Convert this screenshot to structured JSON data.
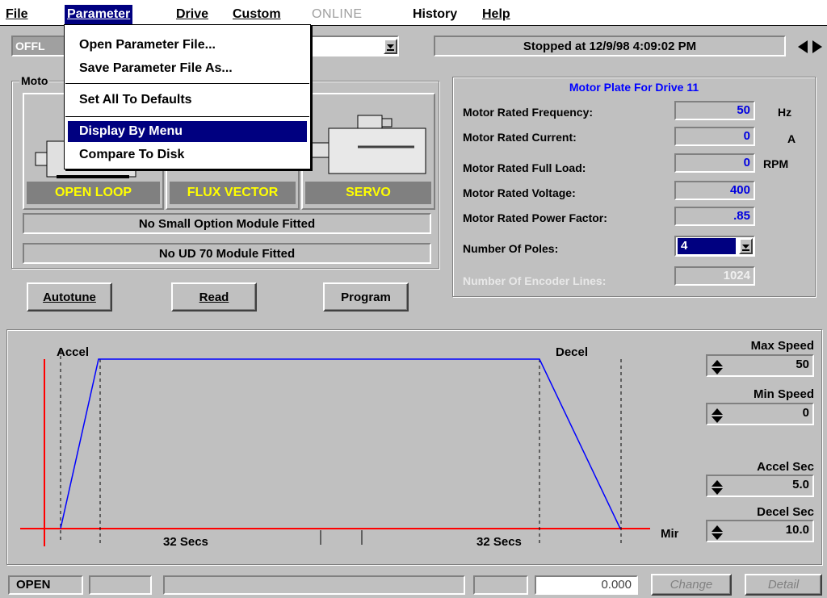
{
  "menubar": {
    "items": [
      "File",
      "Parameter",
      "Drive",
      "Custom",
      "ONLINE",
      "History",
      "Help"
    ]
  },
  "dropdown": {
    "items": [
      "Open Parameter File...",
      "Save Parameter File As...",
      "Set All To Defaults",
      "Display By Menu",
      "Compare To Disk"
    ]
  },
  "toolbar": {
    "mode_text": "OFFL",
    "status_text": "Stopped at 12/9/98 4:09:02 PM"
  },
  "motor_group": {
    "title": "Moto",
    "modes": [
      "OPEN LOOP",
      "FLUX VECTOR",
      "SERVO"
    ],
    "small_option_text": "No Small Option Module Fitted",
    "ud70_text": "No UD 70 Module Fitted"
  },
  "buttons": {
    "autotune": "Autotune",
    "read": "Read",
    "program": "Program"
  },
  "motor_plate": {
    "title": "Motor Plate For Drive 11",
    "rows": [
      {
        "label": "Motor Rated Frequency:",
        "value": "50",
        "unit": "Hz"
      },
      {
        "label": "Motor Rated Current:",
        "value": "0",
        "unit": "A"
      },
      {
        "label": "Motor Rated Full Load:",
        "value": "0",
        "unit": "RPM"
      },
      {
        "label": "Motor Rated Voltage:",
        "value": "400",
        "unit": ""
      },
      {
        "label": "Motor Rated Power Factor:",
        "value": ".85",
        "unit": ""
      }
    ],
    "poles_label": "Number Of Poles:",
    "poles_value": "4",
    "encoder_label": "Number Of Encoder Lines:",
    "encoder_value": "1024"
  },
  "profile": {
    "accel_label": "Accel",
    "decel_label": "Decel",
    "accel_time": "32 Secs",
    "decel_time": "32 Secs",
    "min_label": "Min",
    "colors": {
      "axis": "#ff0000",
      "profile": "#0000ff"
    }
  },
  "spinners": [
    {
      "label": "Max Speed",
      "value": "50"
    },
    {
      "label": "Min Speed",
      "value": "0"
    },
    {
      "label": "Accel Sec",
      "value": "5.0"
    },
    {
      "label": "Decel Sec",
      "value": "10.0"
    }
  ],
  "statusbar": {
    "state": "OPEN",
    "value": "0.000",
    "change": "Change",
    "detail": "Detail"
  }
}
